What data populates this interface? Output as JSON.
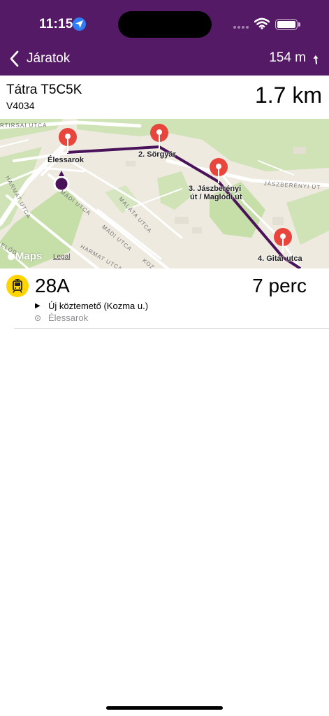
{
  "status_bar": {
    "time": "11:15"
  },
  "nav": {
    "back_label": "Járatok",
    "distance": "154 m"
  },
  "vehicle": {
    "model": "Tátra T5C5K",
    "id": "V4034",
    "distance": "1.7 km"
  },
  "map": {
    "stops": [
      {
        "label": "Élessarok"
      },
      {
        "label": "2. Sörgyár"
      },
      {
        "label_line1": "3. Jászberényi",
        "label_line2": "út / Maglódi út"
      },
      {
        "label": "4. Gitár utca"
      }
    ],
    "streets": {
      "kertirsai": "RTIRSAI UTCA",
      "harmat1": "HARMAT UTCA",
      "madi1": "MÁDI UTCA",
      "malata": "MALÁTA UTCA",
      "madi2": "MÁDI UTCA",
      "harmat2": "HARMAT UTCA",
      "kozma": "KOZ MA",
      "elod": "ELŐD",
      "jaszbereny": "JÁSZBERÉNYI ÚT"
    },
    "logo": "Maps",
    "legal": "Legal",
    "colors": {
      "route": "#4a1259",
      "pin": "#e8453c"
    }
  },
  "departure": {
    "route": "28A",
    "eta": "7 perc",
    "destination": "Új köztemető (Kozma u.)",
    "origin": "Élessarok",
    "icon": "tram-icon",
    "icon_color": "#ffd400"
  },
  "theme": {
    "header_bg": "#551a66"
  }
}
